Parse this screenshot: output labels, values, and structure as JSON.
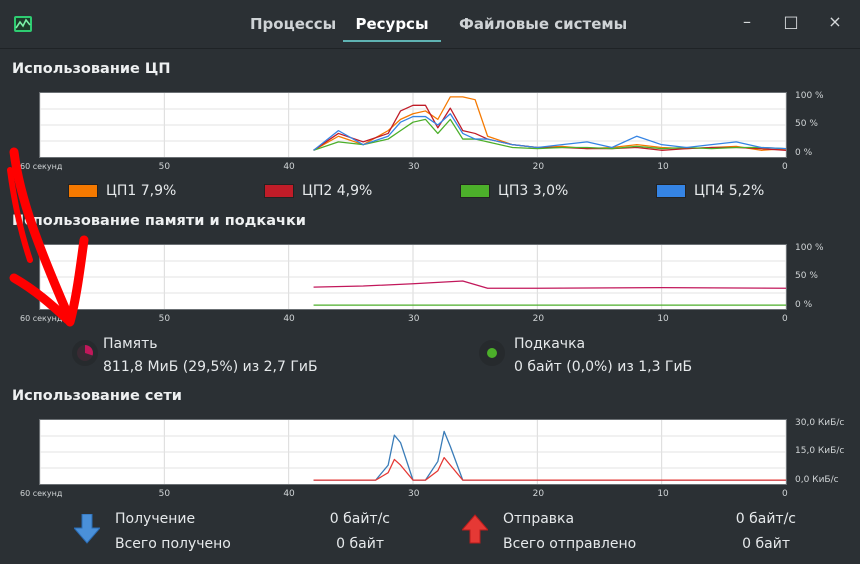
{
  "tabs": [
    {
      "label": "Процессы"
    },
    {
      "label": "Ресурсы"
    },
    {
      "label": "Файловые системы"
    }
  ],
  "window_buttons": {
    "minimize": "–",
    "maximize": "□",
    "close": "×"
  },
  "cpu": {
    "title": "Использование ЦП",
    "x_ticks": [
      "60 секунд",
      "50",
      "40",
      "30",
      "20",
      "10",
      "0"
    ],
    "y_ticks": [
      "100 %",
      "50 %",
      "0 %"
    ],
    "legend": [
      {
        "name": "ЦП1",
        "value": "7,9%",
        "color": "#f57900"
      },
      {
        "name": "ЦП2",
        "value": "4,9%",
        "color": "#c01c28"
      },
      {
        "name": "ЦП3",
        "value": "3,0%",
        "color": "#4caf2a"
      },
      {
        "name": "ЦП4",
        "value": "5,2%",
        "color": "#3584e4"
      }
    ]
  },
  "memory": {
    "title": "Использование памяти и подкачки",
    "x_ticks": [
      "60 секунд",
      "50",
      "40",
      "30",
      "20",
      "10",
      "0"
    ],
    "y_ticks": [
      "100 %",
      "50 %",
      "0 %"
    ],
    "ram_label": "Память",
    "ram_value": "811,8 МиБ (29,5%) из 2,7 ГиБ",
    "ram_color": "#c2185b",
    "swap_label": "Подкачка",
    "swap_value": "0 байт (0,0%) из 1,3 ГиБ",
    "swap_color": "#4caf2a"
  },
  "network": {
    "title": "Использование сети",
    "x_ticks": [
      "60 секунд",
      "50",
      "40",
      "30",
      "20",
      "10",
      "0"
    ],
    "y_ticks": [
      "30,0 КиБ/с",
      "15,0 КиБ/с",
      "0,0 КиБ/с"
    ],
    "receive_label": "Получение",
    "receive_rate": "0 байт/с",
    "receive_total_label": "Всего получено",
    "receive_total": "0 байт",
    "send_label": "Отправка",
    "send_rate": "0 байт/с",
    "send_total_label": "Всего отправлено",
    "send_total": "0 байт"
  },
  "chart_data": [
    {
      "type": "line",
      "title": "Использование ЦП",
      "x": [
        38,
        36,
        34,
        32,
        31,
        30,
        29,
        28,
        27,
        26,
        25,
        24,
        22,
        20,
        18,
        16,
        14,
        12,
        10,
        8,
        6,
        4,
        2,
        0
      ],
      "xlim": [
        60,
        0
      ],
      "ylim": [
        0,
        100
      ],
      "series": [
        {
          "name": "ЦП1",
          "values": [
            5,
            30,
            15,
            40,
            60,
            70,
            75,
            60,
            100,
            100,
            95,
            30,
            15,
            10,
            12,
            8,
            10,
            15,
            10,
            8,
            10,
            12,
            5,
            8
          ]
        },
        {
          "name": "ЦП2",
          "values": [
            5,
            35,
            20,
            35,
            75,
            85,
            85,
            45,
            80,
            40,
            35,
            25,
            15,
            10,
            10,
            8,
            8,
            10,
            5,
            8,
            10,
            10,
            8,
            5
          ]
        },
        {
          "name": "ЦП3",
          "values": [
            5,
            20,
            15,
            25,
            40,
            55,
            60,
            35,
            60,
            25,
            25,
            20,
            10,
            8,
            10,
            10,
            8,
            12,
            8,
            10,
            8,
            10,
            10,
            8
          ]
        },
        {
          "name": "ЦП4",
          "values": [
            5,
            40,
            15,
            30,
            55,
            65,
            65,
            50,
            70,
            35,
            25,
            25,
            15,
            10,
            15,
            20,
            10,
            30,
            15,
            10,
            15,
            20,
            10,
            8
          ]
        }
      ]
    },
    {
      "type": "line",
      "title": "Использование памяти и подкачки",
      "x": [
        38,
        34,
        30,
        26,
        24,
        22,
        20,
        10,
        0
      ],
      "xlim": [
        60,
        0
      ],
      "ylim": [
        0,
        100
      ],
      "series": [
        {
          "name": "Память",
          "values": [
            32,
            34,
            38,
            43,
            30,
            30,
            30,
            31,
            30
          ]
        },
        {
          "name": "Подкачка",
          "values": [
            0,
            0,
            0,
            0,
            0,
            0,
            0,
            0,
            0
          ]
        }
      ]
    },
    {
      "type": "line",
      "title": "Использование сети",
      "x": [
        38,
        33,
        32,
        31.5,
        31,
        30,
        29,
        28,
        27.5,
        27,
        26,
        25,
        20,
        0
      ],
      "xlim": [
        60,
        0
      ],
      "ylim": [
        0,
        30
      ],
      "series": [
        {
          "name": "Получение",
          "values": [
            0,
            0,
            8,
            24,
            20,
            0,
            0,
            10,
            26,
            18,
            0,
            0,
            0,
            0
          ]
        },
        {
          "name": "Отправка",
          "values": [
            0,
            0,
            4,
            11,
            8,
            0,
            0,
            5,
            12,
            8,
            0,
            0,
            0,
            0
          ]
        }
      ]
    }
  ]
}
